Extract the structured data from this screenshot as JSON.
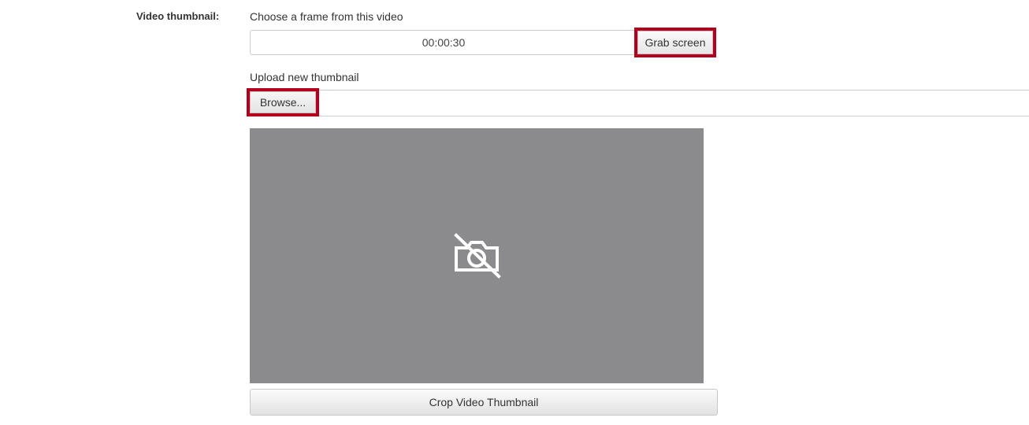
{
  "form": {
    "field_label": "Video thumbnail:",
    "choose_frame": {
      "label": "Choose a frame from this video",
      "timecode": "00:00:30",
      "grab_button_label": "Grab screen"
    },
    "upload": {
      "label": "Upload new thumbnail",
      "browse_button_label": "Browse..."
    },
    "thumbnail": {
      "icon": "no-camera-icon"
    },
    "crop_button_label": "Crop Video Thumbnail"
  },
  "colors": {
    "highlight": "#b5001d",
    "thumbnail_background": "#8b8b8d"
  }
}
